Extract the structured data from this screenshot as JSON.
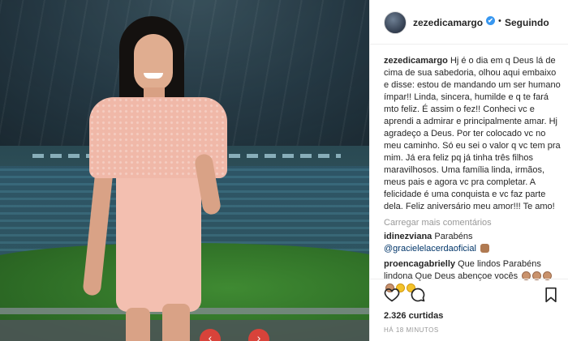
{
  "post": {
    "username": "zezedicamargo",
    "verified_icon": "✔",
    "separator": "•",
    "follow_status": "Seguindo"
  },
  "caption": {
    "username": "zezedicamargo",
    "text": "Hj é o dia em q Deus lá de cima de sua sabedoria, olhou aqui embaixo e disse: estou de mandando um ser humano ímpar!! Linda, sincera, humilde e q te fará mto feliz. É assim o fez!! Conheci vc e aprendi a admirar e principalmente amar. Hj agradeço a Deus. Por ter colocado vc no meu caminho. Só eu sei o valor q vc tem pra mim. Já era feliz pq já tinha três filhos maravilhosos. Uma família linda, irmãos, meus pais e agora vc pra completar. A felicidade é uma conquista e vc faz parte dela. Feliz aniversário meu amor!!! Te amo!"
  },
  "load_more": "Carregar mais comentários",
  "comments": [
    {
      "username": "idinezviana",
      "text": "Parabéns",
      "mention": "@gracielelacerdaoficial",
      "emoji": "cake"
    },
    {
      "username": "proencagabrielly",
      "text": "Que lindos Parabéns lindona Que Deus abençoe vocês",
      "emoji": "clap"
    }
  ],
  "likes": "2.326 curtidas",
  "time": "HÁ 18 MINUTOS",
  "colors": {
    "accent_blue": "#3897f0",
    "text": "#262626",
    "muted": "#999999",
    "border": "#efefef",
    "mention": "#003569"
  },
  "icons": {
    "heart": "heart-icon",
    "comment": "comment-icon",
    "bookmark": "bookmark-icon",
    "prev": "chevron-left-icon",
    "next": "chevron-right-icon"
  },
  "nav": {
    "prev": "‹",
    "next": "›"
  }
}
